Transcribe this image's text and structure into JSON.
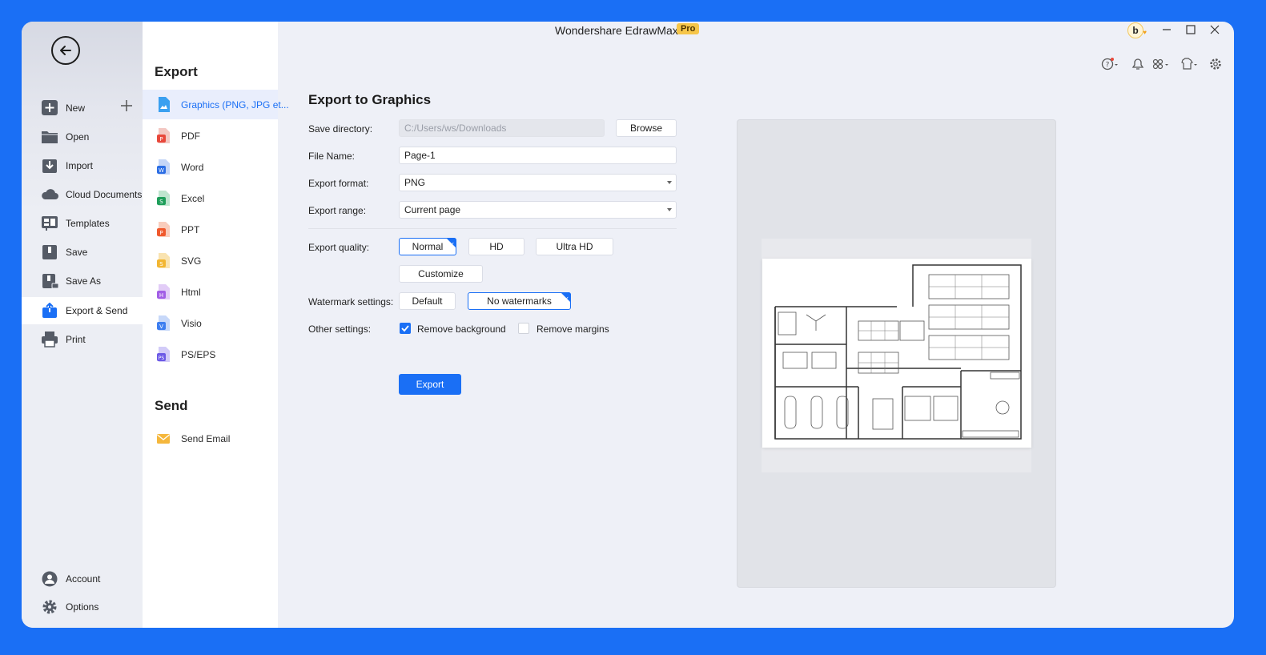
{
  "app": {
    "title": "Wondershare EdrawMax",
    "badge": "Pro",
    "avatar_letter": "b"
  },
  "sidebar": {
    "items": [
      {
        "label": "New",
        "icon": "plus-square-icon"
      },
      {
        "label": "Open",
        "icon": "folder-icon"
      },
      {
        "label": "Import",
        "icon": "import-icon"
      },
      {
        "label": "Cloud Documents",
        "icon": "cloud-icon"
      },
      {
        "label": "Templates",
        "icon": "templates-icon"
      },
      {
        "label": "Save",
        "icon": "save-icon"
      },
      {
        "label": "Save As",
        "icon": "save-as-icon"
      },
      {
        "label": "Export & Send",
        "icon": "export-icon"
      },
      {
        "label": "Print",
        "icon": "printer-icon"
      }
    ],
    "bottom": [
      {
        "label": "Account",
        "icon": "account-icon"
      },
      {
        "label": "Options",
        "icon": "gear-icon"
      }
    ],
    "active": "Export & Send"
  },
  "export_list": {
    "export_heading": "Export",
    "send_heading": "Send",
    "formats": [
      {
        "label": "Graphics (PNG, JPG et...",
        "color": "#3aa0f0"
      },
      {
        "label": "PDF",
        "color": "#e8483b"
      },
      {
        "label": "Word",
        "color": "#2b6de4"
      },
      {
        "label": "Excel",
        "color": "#1e9e5a"
      },
      {
        "label": "PPT",
        "color": "#f0592d"
      },
      {
        "label": "SVG",
        "color": "#f2b632"
      },
      {
        "label": "Html",
        "color": "#a25ee6"
      },
      {
        "label": "Visio",
        "color": "#3d7ef0"
      },
      {
        "label": "PS/EPS",
        "color": "#6b59e6"
      }
    ],
    "send": [
      {
        "label": "Send Email",
        "color": "#f5b73c"
      }
    ]
  },
  "panel": {
    "title": "Export to Graphics",
    "save_directory": {
      "label": "Save directory:",
      "value": "C:/Users/ws/Downloads",
      "browse": "Browse"
    },
    "file_name": {
      "label": "File Name:",
      "value": "Page-1"
    },
    "export_format": {
      "label": "Export format:",
      "value": "PNG"
    },
    "export_range": {
      "label": "Export range:",
      "value": "Current page"
    },
    "export_quality": {
      "label": "Export quality:",
      "options": [
        "Normal",
        "HD",
        "Ultra HD"
      ],
      "selected": "Normal",
      "customize": "Customize"
    },
    "watermark": {
      "label": "Watermark settings:",
      "options": [
        "Default",
        "No watermarks"
      ],
      "selected": "No watermarks"
    },
    "other": {
      "label": "Other settings:",
      "remove_background": "Remove background",
      "remove_background_checked": true,
      "remove_margins": "Remove margins",
      "remove_margins_checked": false
    },
    "export_button": "Export"
  },
  "colors": {
    "accent": "#1a6ff5",
    "frame": "#1a6ff5"
  }
}
